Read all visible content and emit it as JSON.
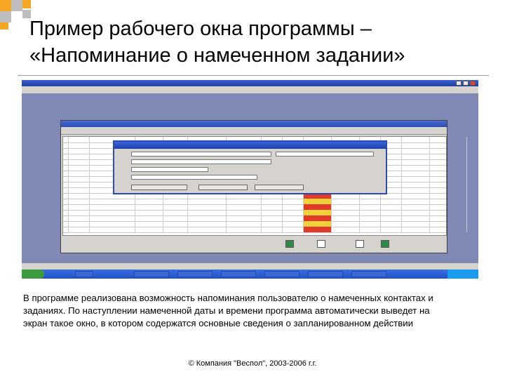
{
  "slide": {
    "title_line1": "Пример рабочего окна программы –",
    "title_line2": "«Напоминание о намеченном задании»",
    "caption_line1": "В программе реализована возможность напоминания пользователю о намеченных контактах и",
    "caption_line2": "заданиях. По наступлении намеченной даты и времени программа автоматически выведет на",
    "caption_line3": "экран такое окно, в котором содержатся основные сведения о запланированном действии",
    "footer": "© Компания \"Веспол\", 2003-2006 г.г."
  },
  "colors": {
    "accent_orange": "#f5a623",
    "accent_gray": "#bdbdbd",
    "workspace": "#8088b6",
    "titlebar_blue": "#2a4bb4"
  },
  "icons": [
    "deco-squares-icon",
    "window-minimize-icon",
    "window-maximize-icon",
    "window-close-icon",
    "nav-first-icon",
    "nav-prev-icon",
    "nav-next-icon",
    "nav-last-icon"
  ]
}
